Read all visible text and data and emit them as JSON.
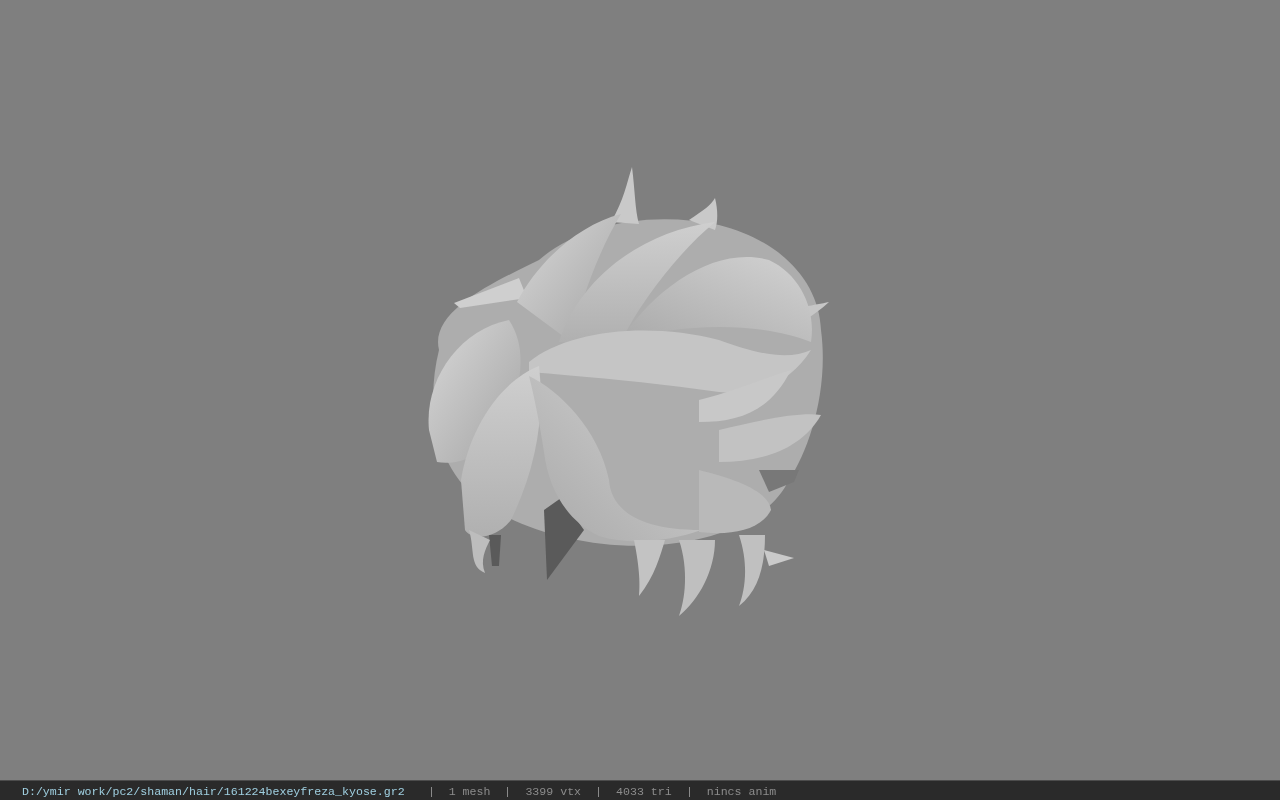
{
  "status_bar": {
    "file_path": "D:/ymir work/pc2/shaman/hair/161224bexeyfreza_kyose.gr2",
    "stats": [
      "1 mesh",
      "3399 vtx",
      "4033 tri",
      "nincs anim"
    ]
  }
}
